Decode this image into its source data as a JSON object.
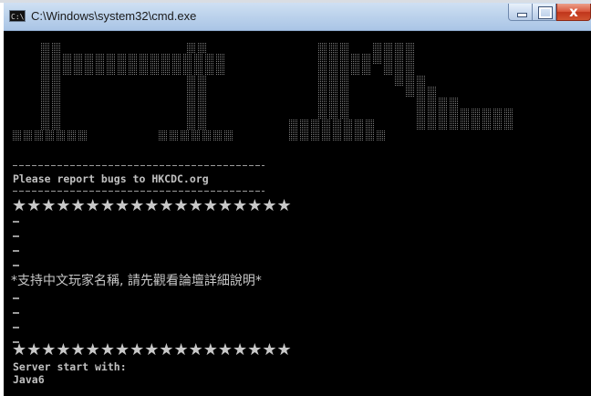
{
  "window": {
    "title": "C:\\Windows\\system32\\cmd.exe",
    "icon": "cmd-icon",
    "controls": {
      "minimize": "minimize-icon",
      "maximize": "maximize-icon",
      "close_label": "x"
    }
  },
  "console": {
    "banner": "ascii-art-banner",
    "report_line": "Please report bugs to HKCDC.org",
    "stars_top": "★★★★★★★★★★★★★★★★★★★",
    "stars_bottom": "★★★★★★★★★★★★★★★★★★★",
    "notice": "*支持中文玩家名稱, 請先觀看論壇詳細說明*",
    "server_start": "Server start with:",
    "java_version": "Java6"
  },
  "colors": {
    "console_bg": "#000000",
    "console_text": "#c0c0c0",
    "title_gradient": "#bdd3ec",
    "close_button": "#c0351b"
  }
}
